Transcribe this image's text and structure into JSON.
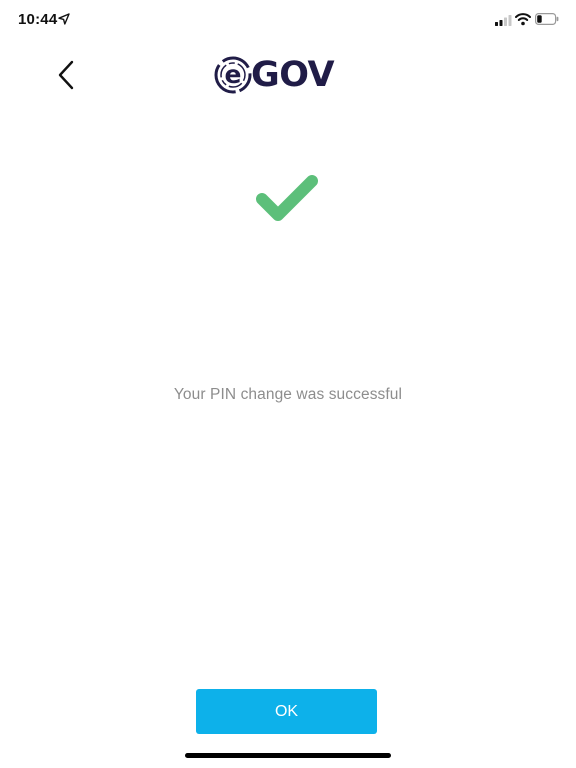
{
  "status_bar": {
    "time": "10:44",
    "icons": [
      "location-arrow-icon",
      "cellular-signal-icon",
      "wifi-icon",
      "battery-icon"
    ]
  },
  "nav": {
    "back_icon": "chevron-left-icon",
    "logo_text": "GOV",
    "logo_mark": "e"
  },
  "success": {
    "icon": "checkmark-icon",
    "message": "Your PIN change was successful"
  },
  "actions": {
    "ok_label": "OK"
  },
  "colors": {
    "brand_navy": "#201c47",
    "check_green": "#5cbf7a",
    "button_blue": "#0db1ea",
    "message_gray": "#8d8d8d"
  }
}
